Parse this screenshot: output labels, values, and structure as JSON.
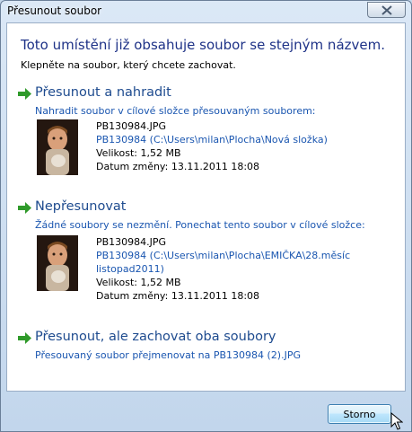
{
  "window": {
    "title": "Přesunout soubor"
  },
  "dialog": {
    "heading": "Toto umístění již obsahuje soubor se stejným názvem.",
    "instruction": "Klepněte na soubor, který chcete zachovat."
  },
  "options": [
    {
      "title": "Přesunout a nahradit",
      "description": "Nahradit soubor v cílové složce přesouvaným souborem:",
      "file": {
        "name": "PB130984.JPG",
        "path_lines": [
          "PB130984 (C:\\Users\\milan\\Plocha\\Nová složka)"
        ],
        "size": "Velikost: 1,52 MB",
        "modified": "Datum změny: 13.11.2011 18:08"
      }
    },
    {
      "title": "Nepřesunovat",
      "description": "Žádné soubory se nezmění. Ponechat tento soubor v cílové složce:",
      "file": {
        "name": "PB130984.JPG",
        "path_lines": [
          "PB130984 (C:\\Users\\milan\\Plocha\\EMIČKA\\28.měsíc",
          "listopad2011)"
        ],
        "size": "Velikost: 1,52 MB",
        "modified": "Datum změny: 13.11.2011 18:08"
      }
    },
    {
      "title": "Přesunout, ale zachovat oba soubory",
      "description": "Přesouvaný soubor přejmenovat na PB130984 (2).JPG"
    }
  ],
  "footer": {
    "cancel_label": "Storno"
  },
  "icons": {
    "option_arrow": "green-arrow-icon",
    "close": "close-icon",
    "cursor": "mouse-cursor-icon",
    "thumbnail": "photo-thumbnail"
  },
  "colors": {
    "heading": "#1e3287",
    "link": "#1a56b0",
    "arrow": "#2f9a2a"
  }
}
